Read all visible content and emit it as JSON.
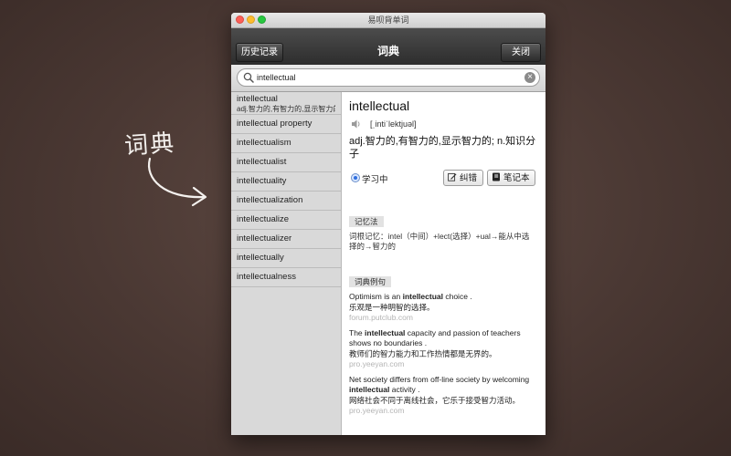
{
  "annotation": {
    "text": "词典"
  },
  "window": {
    "title": "易呗背单词"
  },
  "toolbar": {
    "history_label": "历史记录",
    "title": "词典",
    "close_label": "关闭"
  },
  "search": {
    "value": "intellectual"
  },
  "list": {
    "first": {
      "word": "intellectual",
      "sub": "adj.智力的,有智力的,显示智力的"
    },
    "items": [
      "intellectual property",
      "intellectualism",
      "intellectualist",
      "intellectuality",
      "intellectualization",
      "intellectualize",
      "intellectualizer",
      "intellectually",
      "intellectualness"
    ]
  },
  "detail": {
    "word": "intellectual",
    "phonetic": "[ˌintiˈlektjuəl]",
    "definition": "adj.智力的,有智力的,显示智力的; n.知识分子",
    "status_label": "学习中",
    "correct_label": "纠错",
    "notebook_label": "笔记本",
    "mnemonic_label": "记忆法",
    "mnemonic_text": "词根记忆：intel（中间）+lect(选择）+ual→能从中选择的→智力的",
    "examples_label": "词典例句",
    "examples": [
      {
        "en_before": "Optimism is an ",
        "en_bold": "intellectual",
        "en_after": " choice .",
        "zh": "乐观是一种明智的选择。",
        "source": "forum.putclub.com"
      },
      {
        "en_before": "The ",
        "en_bold": "intellectual",
        "en_after": " capacity and passion of teachers shows no boundaries .",
        "zh": "教师们的智力能力和工作热情都是无界的。",
        "source": "pro.yeeyan.com"
      },
      {
        "en_before": "Net society differs from off-line society by welcoming ",
        "en_bold": "intellectual",
        "en_after": " activity .",
        "zh": "网络社会不同于离线社会，它乐于接受智力活动。",
        "source": "pro.yeeyan.com"
      }
    ]
  }
}
